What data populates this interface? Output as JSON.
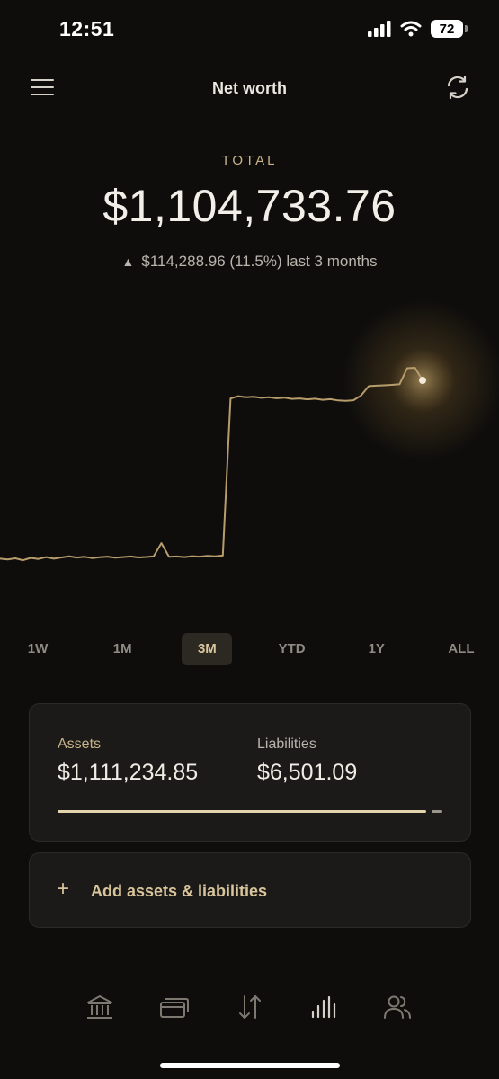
{
  "status_bar": {
    "time": "12:51",
    "battery": "72",
    "icons": [
      "cellular-signal-icon",
      "wifi-icon",
      "battery-icon"
    ]
  },
  "header": {
    "title": "Net worth",
    "menu_icon": "hamburger-menu-icon",
    "refresh_icon": "refresh-icon"
  },
  "summary": {
    "total_label": "TOTAL",
    "total_value": "$1,104,733.76",
    "change_text": "$114,288.96 (11.5%) last 3 months",
    "change_direction_icon": "triangle-up-icon"
  },
  "chart_data": {
    "type": "line",
    "title": "",
    "xlabel": "",
    "ylabel": "",
    "grid": false,
    "legend": "none",
    "series": [
      {
        "color": "#b89d6c",
        "values": [
          990000,
          989500,
          990200,
          989000,
          990500,
          989800,
          991000,
          990000,
          990800,
          991500,
          990700,
          991200,
          990400,
          990900,
          991300,
          990600,
          991000,
          991400,
          990800,
          991100,
          991500,
          1000000,
          991200,
          991400,
          991000,
          991600,
          991300,
          991800,
          991500,
          992000,
          1093000,
          1094500,
          1093800,
          1094200,
          1093500,
          1093900,
          1093200,
          1093600,
          1092800,
          1093100,
          1092500,
          1092900,
          1092200,
          1092600,
          1091800,
          1091600,
          1091900,
          1095000,
          1101000,
          1101300,
          1101500,
          1101800,
          1102200,
          1112500,
          1112800,
          1104700
        ]
      }
    ],
    "current_value": 1104733.76
  },
  "ranges": {
    "items": [
      "1W",
      "1M",
      "3M",
      "YTD",
      "1Y",
      "ALL"
    ],
    "selected": "3M"
  },
  "balances": {
    "assets_label": "Assets",
    "assets_value": "$1,111,234.85",
    "liabilities_label": "Liabilities",
    "liabilities_value": "$6,501.09",
    "assets_share": 0.9942,
    "liabilities_share": 0.0058
  },
  "add": {
    "icon": "plus-icon",
    "label": "Add assets & liabilities"
  },
  "tabbar": {
    "items": [
      {
        "icon": "bank-icon",
        "name": "accounts"
      },
      {
        "icon": "cards-icon",
        "name": "cards"
      },
      {
        "icon": "transfer-arrows-icon",
        "name": "transactions"
      },
      {
        "icon": "bar-chart-icon",
        "name": "net-worth"
      },
      {
        "icon": "people-icon",
        "name": "people"
      }
    ],
    "active": "net-worth"
  },
  "colors": {
    "background": "#0e0d0c",
    "accent": "#d9c59c",
    "chart_line": "#b89d6c",
    "card": "#1b1a18"
  }
}
